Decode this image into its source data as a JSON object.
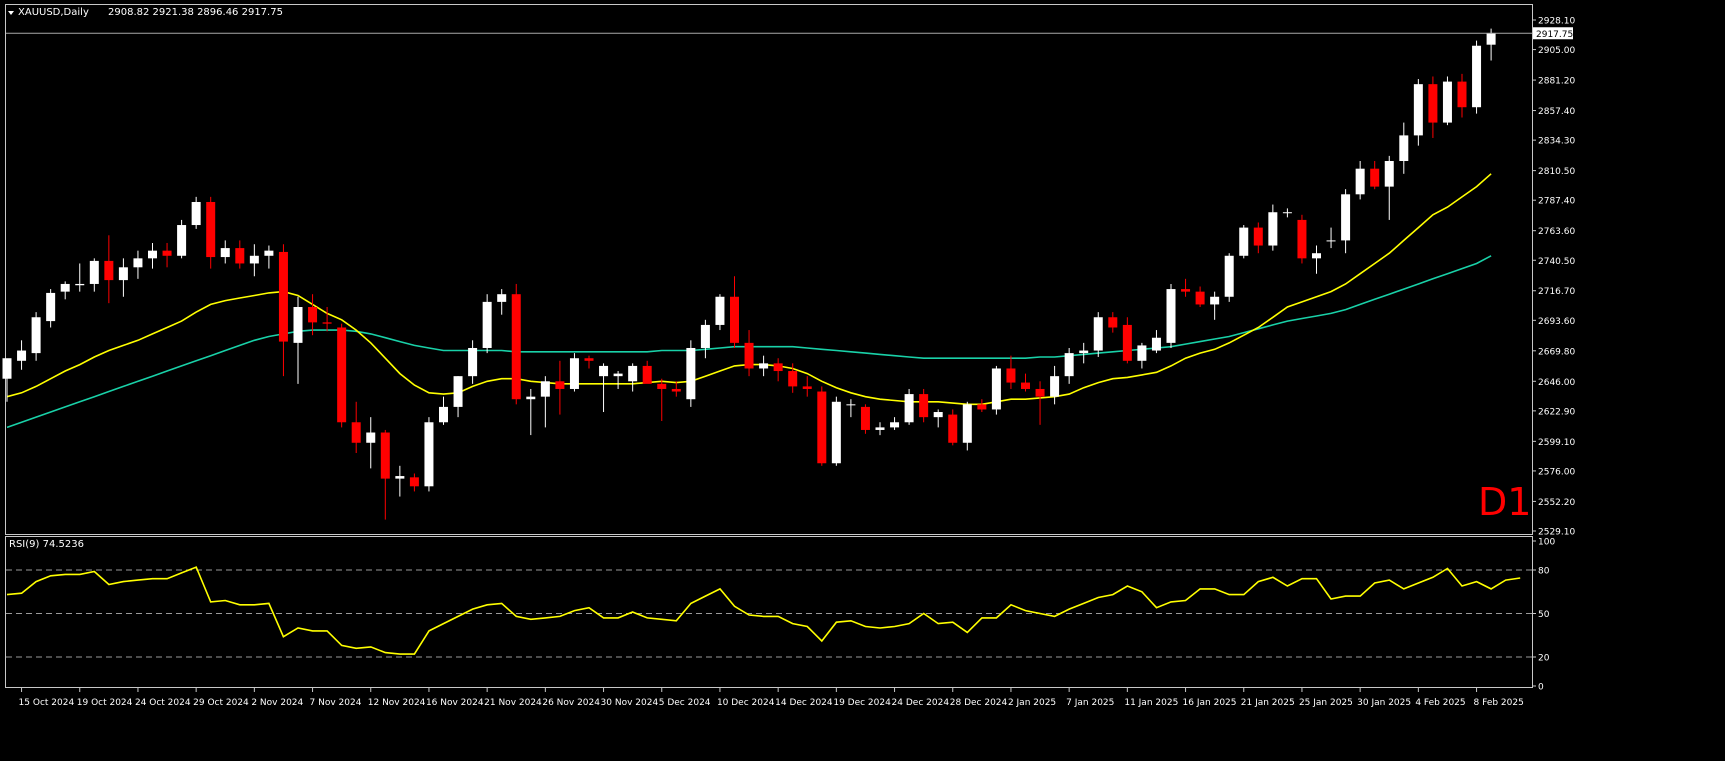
{
  "colors": {
    "background": "#000000",
    "frame": "#c8c8c8",
    "bull_candle": "#ffffff",
    "bear_candle": "#ff0000",
    "ma_fast": "#ffff00",
    "ma_slow": "#19d1a8",
    "rsi_line": "#ffff00",
    "rsi_levels": "#9a9a9a",
    "text": "#ffffff",
    "timeframe_label": "#ff0000"
  },
  "chart_data": {
    "type": "candlestick",
    "symbol_title": "XAUUSD,Daily",
    "ohlc_header": "2908.82 2921.38 2896.46 2917.75",
    "timeframe_label": "D1",
    "current_price": 2917.75,
    "price_range": [
      2529.1,
      2928.1
    ],
    "price_ticks": [
      "2928.10",
      "2905.00",
      "2881.20",
      "2857.40",
      "2834.30",
      "2810.50",
      "2787.40",
      "2763.60",
      "2740.50",
      "2716.70",
      "2693.60",
      "2669.80",
      "2646.00",
      "2622.90",
      "2599.10",
      "2576.00",
      "2552.20",
      "2529.10"
    ],
    "date_ticks": [
      {
        "label": "15 Oct 2024",
        "index": 1
      },
      {
        "label": "19 Oct 2024",
        "index": 5
      },
      {
        "label": "24 Oct 2024",
        "index": 9
      },
      {
        "label": "29 Oct 2024",
        "index": 13
      },
      {
        "label": "2 Nov 2024",
        "index": 17
      },
      {
        "label": "7 Nov 2024",
        "index": 21
      },
      {
        "label": "12 Nov 2024",
        "index": 25
      },
      {
        "label": "16 Nov 2024",
        "index": 29
      },
      {
        "label": "21 Nov 2024",
        "index": 33
      },
      {
        "label": "26 Nov 2024",
        "index": 37
      },
      {
        "label": "30 Nov 2024",
        "index": 41
      },
      {
        "label": "5 Dec 2024",
        "index": 45
      },
      {
        "label": "10 Dec 2024",
        "index": 49
      },
      {
        "label": "14 Dec 2024",
        "index": 53
      },
      {
        "label": "19 Dec 2024",
        "index": 57
      },
      {
        "label": "24 Dec 2024",
        "index": 61
      },
      {
        "label": "28 Dec 2024",
        "index": 65
      },
      {
        "label": "2 Jan 2025",
        "index": 69
      },
      {
        "label": "7 Jan 2025",
        "index": 73
      },
      {
        "label": "11 Jan 2025",
        "index": 77
      },
      {
        "label": "16 Jan 2025",
        "index": 81
      },
      {
        "label": "21 Jan 2025",
        "index": 85
      },
      {
        "label": "25 Jan 2025",
        "index": 89
      },
      {
        "label": "30 Jan 2025",
        "index": 93
      },
      {
        "label": "4 Feb 2025",
        "index": 97
      },
      {
        "label": "8 Feb 2025",
        "index": 101
      }
    ],
    "candles": [
      {
        "o": 2648,
        "h": 2660,
        "l": 2630,
        "c": 2664
      },
      {
        "o": 2662,
        "h": 2678,
        "l": 2655,
        "c": 2670
      },
      {
        "o": 2668,
        "h": 2700,
        "l": 2662,
        "c": 2696
      },
      {
        "o": 2693,
        "h": 2718,
        "l": 2688,
        "c": 2715
      },
      {
        "o": 2716,
        "h": 2724,
        "l": 2710,
        "c": 2722
      },
      {
        "o": 2721,
        "h": 2738,
        "l": 2716,
        "c": 2722
      },
      {
        "o": 2722,
        "h": 2742,
        "l": 2716,
        "c": 2740
      },
      {
        "o": 2740,
        "h": 2760,
        "l": 2707,
        "c": 2725
      },
      {
        "o": 2725,
        "h": 2742,
        "l": 2712,
        "c": 2735
      },
      {
        "o": 2735,
        "h": 2748,
        "l": 2726,
        "c": 2742
      },
      {
        "o": 2742,
        "h": 2754,
        "l": 2734,
        "c": 2748
      },
      {
        "o": 2748,
        "h": 2754,
        "l": 2735,
        "c": 2744
      },
      {
        "o": 2744,
        "h": 2772,
        "l": 2742,
        "c": 2768
      },
      {
        "o": 2768,
        "h": 2790,
        "l": 2765,
        "c": 2786
      },
      {
        "o": 2786,
        "h": 2790,
        "l": 2734,
        "c": 2743
      },
      {
        "o": 2743,
        "h": 2756,
        "l": 2738,
        "c": 2750
      },
      {
        "o": 2750,
        "h": 2756,
        "l": 2734,
        "c": 2738
      },
      {
        "o": 2738,
        "h": 2753,
        "l": 2728,
        "c": 2744
      },
      {
        "o": 2744,
        "h": 2752,
        "l": 2734,
        "c": 2748
      },
      {
        "o": 2747,
        "h": 2753,
        "l": 2650,
        "c": 2677
      },
      {
        "o": 2676,
        "h": 2712,
        "l": 2644,
        "c": 2704
      },
      {
        "o": 2704,
        "h": 2714,
        "l": 2682,
        "c": 2692
      },
      {
        "o": 2692,
        "h": 2704,
        "l": 2685,
        "c": 2691
      },
      {
        "o": 2688,
        "h": 2691,
        "l": 2610,
        "c": 2614
      },
      {
        "o": 2614,
        "h": 2630,
        "l": 2590,
        "c": 2598
      },
      {
        "o": 2598,
        "h": 2618,
        "l": 2578,
        "c": 2606
      },
      {
        "o": 2606,
        "h": 2608,
        "l": 2538,
        "c": 2570
      },
      {
        "o": 2570,
        "h": 2580,
        "l": 2556,
        "c": 2572
      },
      {
        "o": 2571,
        "h": 2574,
        "l": 2560,
        "c": 2564
      },
      {
        "o": 2564,
        "h": 2618,
        "l": 2560,
        "c": 2614
      },
      {
        "o": 2614,
        "h": 2634,
        "l": 2612,
        "c": 2626
      },
      {
        "o": 2626,
        "h": 2650,
        "l": 2618,
        "c": 2650
      },
      {
        "o": 2650,
        "h": 2678,
        "l": 2644,
        "c": 2672
      },
      {
        "o": 2672,
        "h": 2714,
        "l": 2668,
        "c": 2708
      },
      {
        "o": 2708,
        "h": 2718,
        "l": 2698,
        "c": 2714
      },
      {
        "o": 2714,
        "h": 2722,
        "l": 2628,
        "c": 2632
      },
      {
        "o": 2632,
        "h": 2640,
        "l": 2604,
        "c": 2634
      },
      {
        "o": 2634,
        "h": 2650,
        "l": 2610,
        "c": 2646
      },
      {
        "o": 2646,
        "h": 2662,
        "l": 2620,
        "c": 2640
      },
      {
        "o": 2640,
        "h": 2668,
        "l": 2638,
        "c": 2664
      },
      {
        "o": 2664,
        "h": 2666,
        "l": 2656,
        "c": 2662
      },
      {
        "o": 2650,
        "h": 2660,
        "l": 2622,
        "c": 2658
      },
      {
        "o": 2650,
        "h": 2654,
        "l": 2640,
        "c": 2652
      },
      {
        "o": 2646,
        "h": 2660,
        "l": 2638,
        "c": 2658
      },
      {
        "o": 2658,
        "h": 2662,
        "l": 2645,
        "c": 2644
      },
      {
        "o": 2644,
        "h": 2648,
        "l": 2615,
        "c": 2640
      },
      {
        "o": 2640,
        "h": 2646,
        "l": 2634,
        "c": 2638
      },
      {
        "o": 2632,
        "h": 2678,
        "l": 2626,
        "c": 2672
      },
      {
        "o": 2672,
        "h": 2694,
        "l": 2664,
        "c": 2690
      },
      {
        "o": 2690,
        "h": 2714,
        "l": 2686,
        "c": 2712
      },
      {
        "o": 2712,
        "h": 2728,
        "l": 2672,
        "c": 2676
      },
      {
        "o": 2676,
        "h": 2686,
        "l": 2650,
        "c": 2656
      },
      {
        "o": 2656,
        "h": 2666,
        "l": 2650,
        "c": 2660
      },
      {
        "o": 2660,
        "h": 2664,
        "l": 2646,
        "c": 2654
      },
      {
        "o": 2654,
        "h": 2660,
        "l": 2637,
        "c": 2642
      },
      {
        "o": 2642,
        "h": 2650,
        "l": 2634,
        "c": 2640
      },
      {
        "o": 2638,
        "h": 2642,
        "l": 2580,
        "c": 2582
      },
      {
        "o": 2582,
        "h": 2634,
        "l": 2580,
        "c": 2630
      },
      {
        "o": 2628,
        "h": 2632,
        "l": 2618,
        "c": 2628
      },
      {
        "o": 2626,
        "h": 2628,
        "l": 2605,
        "c": 2608
      },
      {
        "o": 2608,
        "h": 2614,
        "l": 2604,
        "c": 2610
      },
      {
        "o": 2610,
        "h": 2618,
        "l": 2608,
        "c": 2614
      },
      {
        "o": 2614,
        "h": 2640,
        "l": 2612,
        "c": 2636
      },
      {
        "o": 2636,
        "h": 2640,
        "l": 2614,
        "c": 2618
      },
      {
        "o": 2618,
        "h": 2624,
        "l": 2610,
        "c": 2622
      },
      {
        "o": 2620,
        "h": 2624,
        "l": 2596,
        "c": 2598
      },
      {
        "o": 2598,
        "h": 2630,
        "l": 2592,
        "c": 2628
      },
      {
        "o": 2628,
        "h": 2632,
        "l": 2622,
        "c": 2624
      },
      {
        "o": 2624,
        "h": 2658,
        "l": 2620,
        "c": 2656
      },
      {
        "o": 2656,
        "h": 2666,
        "l": 2640,
        "c": 2645
      },
      {
        "o": 2645,
        "h": 2652,
        "l": 2638,
        "c": 2640
      },
      {
        "o": 2640,
        "h": 2646,
        "l": 2612,
        "c": 2634
      },
      {
        "o": 2634,
        "h": 2658,
        "l": 2628,
        "c": 2650
      },
      {
        "o": 2650,
        "h": 2672,
        "l": 2644,
        "c": 2668
      },
      {
        "o": 2668,
        "h": 2676,
        "l": 2660,
        "c": 2670
      },
      {
        "o": 2670,
        "h": 2700,
        "l": 2665,
        "c": 2696
      },
      {
        "o": 2696,
        "h": 2700,
        "l": 2684,
        "c": 2688
      },
      {
        "o": 2690,
        "h": 2696,
        "l": 2660,
        "c": 2662
      },
      {
        "o": 2662,
        "h": 2676,
        "l": 2656,
        "c": 2674
      },
      {
        "o": 2670,
        "h": 2686,
        "l": 2668,
        "c": 2680
      },
      {
        "o": 2676,
        "h": 2722,
        "l": 2672,
        "c": 2718
      },
      {
        "o": 2718,
        "h": 2726,
        "l": 2712,
        "c": 2716
      },
      {
        "o": 2716,
        "h": 2720,
        "l": 2704,
        "c": 2706
      },
      {
        "o": 2706,
        "h": 2716,
        "l": 2694,
        "c": 2712
      },
      {
        "o": 2712,
        "h": 2746,
        "l": 2708,
        "c": 2744
      },
      {
        "o": 2744,
        "h": 2768,
        "l": 2742,
        "c": 2766
      },
      {
        "o": 2766,
        "h": 2770,
        "l": 2746,
        "c": 2752
      },
      {
        "o": 2752,
        "h": 2784,
        "l": 2748,
        "c": 2778
      },
      {
        "o": 2778,
        "h": 2781,
        "l": 2774,
        "c": 2778
      },
      {
        "o": 2772,
        "h": 2776,
        "l": 2738,
        "c": 2742
      },
      {
        "o": 2742,
        "h": 2752,
        "l": 2730,
        "c": 2746
      },
      {
        "o": 2756,
        "h": 2766,
        "l": 2750,
        "c": 2756
      },
      {
        "o": 2756,
        "h": 2796,
        "l": 2746,
        "c": 2792
      },
      {
        "o": 2792,
        "h": 2818,
        "l": 2788,
        "c": 2812
      },
      {
        "o": 2812,
        "h": 2818,
        "l": 2796,
        "c": 2798
      },
      {
        "o": 2798,
        "h": 2822,
        "l": 2772,
        "c": 2818
      },
      {
        "o": 2818,
        "h": 2848,
        "l": 2808,
        "c": 2838
      },
      {
        "o": 2838,
        "h": 2882,
        "l": 2830,
        "c": 2878
      },
      {
        "o": 2878,
        "h": 2884,
        "l": 2836,
        "c": 2848
      },
      {
        "o": 2848,
        "h": 2884,
        "l": 2846,
        "c": 2880
      },
      {
        "o": 2880,
        "h": 2886,
        "l": 2852,
        "c": 2860
      },
      {
        "o": 2860,
        "h": 2912,
        "l": 2855,
        "c": 2908
      },
      {
        "o": 2908.82,
        "h": 2921.38,
        "l": 2896.46,
        "c": 2917.75
      }
    ],
    "ma_fast": [
      2634,
      2637,
      2642,
      2648,
      2654,
      2659,
      2665,
      2670,
      2674,
      2678,
      2683,
      2688,
      2693,
      2700,
      2706,
      2709,
      2711,
      2713,
      2715,
      2716,
      2713,
      2706,
      2699,
      2694,
      2686,
      2676,
      2664,
      2652,
      2643,
      2637,
      2636,
      2637,
      2642,
      2646,
      2648,
      2648,
      2646,
      2645,
      2644,
      2644,
      2644,
      2644,
      2644,
      2644,
      2645,
      2646,
      2645,
      2646,
      2650,
      2654,
      2658,
      2659,
      2659,
      2658,
      2656,
      2652,
      2646,
      2641,
      2637,
      2634,
      2632,
      2631,
      2630,
      2630,
      2630,
      2629,
      2628,
      2628,
      2630,
      2632,
      2632,
      2633,
      2634,
      2636,
      2641,
      2645,
      2648,
      2649,
      2651,
      2653,
      2658,
      2664,
      2668,
      2671,
      2676,
      2682,
      2688,
      2696,
      2704,
      2708,
      2712,
      2716,
      2722,
      2730,
      2738,
      2746,
      2756,
      2766,
      2776,
      2782,
      2790,
      2798,
      2808
    ],
    "ma_slow": [
      2610,
      2614,
      2618,
      2622,
      2626,
      2630,
      2634,
      2638,
      2642,
      2646,
      2650,
      2654,
      2658,
      2662,
      2666,
      2670,
      2674,
      2678,
      2681,
      2683,
      2685,
      2686,
      2686,
      2686,
      2685,
      2683,
      2680,
      2677,
      2674,
      2672,
      2670,
      2670,
      2670,
      2670,
      2670,
      2669,
      2669,
      2669,
      2669,
      2669,
      2669,
      2669,
      2669,
      2669,
      2669,
      2670,
      2670,
      2670,
      2671,
      2672,
      2673,
      2673,
      2673,
      2673,
      2673,
      2672,
      2671,
      2670,
      2669,
      2668,
      2667,
      2666,
      2665,
      2664,
      2664,
      2664,
      2664,
      2664,
      2664,
      2664,
      2664,
      2665,
      2665,
      2666,
      2667,
      2668,
      2669,
      2670,
      2671,
      2672,
      2673,
      2675,
      2677,
      2679,
      2681,
      2684,
      2687,
      2690,
      2693,
      2695,
      2697,
      2699,
      2702,
      2706,
      2710,
      2714,
      2718,
      2722,
      2726,
      2730,
      2734,
      2738,
      2744
    ],
    "rsi": {
      "label": "RSI(9) 74.5236",
      "scale_ticks": [
        "100",
        "80",
        "50",
        "20",
        "0"
      ],
      "levels": [
        80,
        50,
        20
      ],
      "values": [
        63,
        64,
        72,
        76,
        77,
        77,
        79,
        70,
        72,
        73,
        74,
        74,
        78,
        82,
        58,
        59,
        56,
        56,
        57,
        34,
        40,
        38,
        38,
        28,
        26,
        27,
        23,
        22,
        22,
        38,
        43,
        48,
        53,
        56,
        57,
        48,
        46,
        47,
        48,
        52,
        54,
        47,
        47,
        51,
        47,
        46,
        45,
        57,
        62,
        67,
        55,
        49,
        48,
        48,
        43,
        41,
        31,
        44,
        45,
        41,
        40,
        41,
        43,
        50,
        43,
        44,
        37,
        47,
        47,
        56,
        52,
        50,
        48,
        53,
        57,
        61,
        63,
        69,
        65,
        54,
        58,
        59,
        67,
        67,
        63,
        63,
        72,
        75,
        69,
        74,
        74,
        60,
        62,
        62,
        71,
        73,
        67,
        71,
        75,
        81,
        69,
        72,
        67,
        73,
        74.5
      ]
    }
  }
}
